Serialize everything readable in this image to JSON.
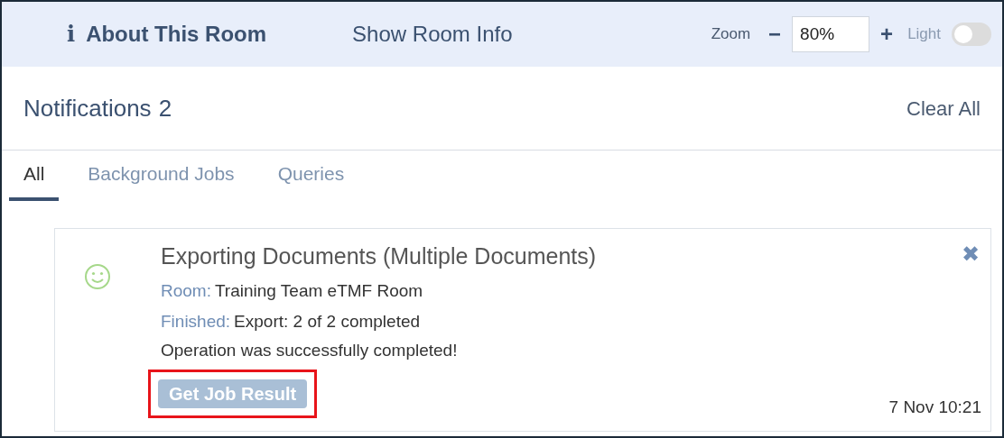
{
  "header": {
    "about": "About This Room",
    "about_icon": "i",
    "show_info": "Show Room Info",
    "zoom_label": "Zoom",
    "zoom_minus": "−",
    "zoom_value": "80%",
    "zoom_plus": "+",
    "theme_label": "Light",
    "theme_on": false
  },
  "notifications": {
    "title": "Notifications",
    "count": "2",
    "clear": "Clear All"
  },
  "tabs": [
    {
      "label": "All",
      "selected": true
    },
    {
      "label": "Background Jobs",
      "selected": false
    },
    {
      "label": "Queries",
      "selected": false
    }
  ],
  "card": {
    "title": "Exporting Documents (Multiple Documents)",
    "close": "✖",
    "lines": [
      {
        "label": "Room:",
        "value": "Training Team eTMF Room"
      },
      {
        "label": "Finished:",
        "value": "Export: 2 of 2 completed"
      }
    ],
    "message": "Operation was successfully completed!",
    "button": "Get Job Result",
    "button_disabled": true,
    "highlighted": true,
    "time": "7 Nov 10:21"
  }
}
